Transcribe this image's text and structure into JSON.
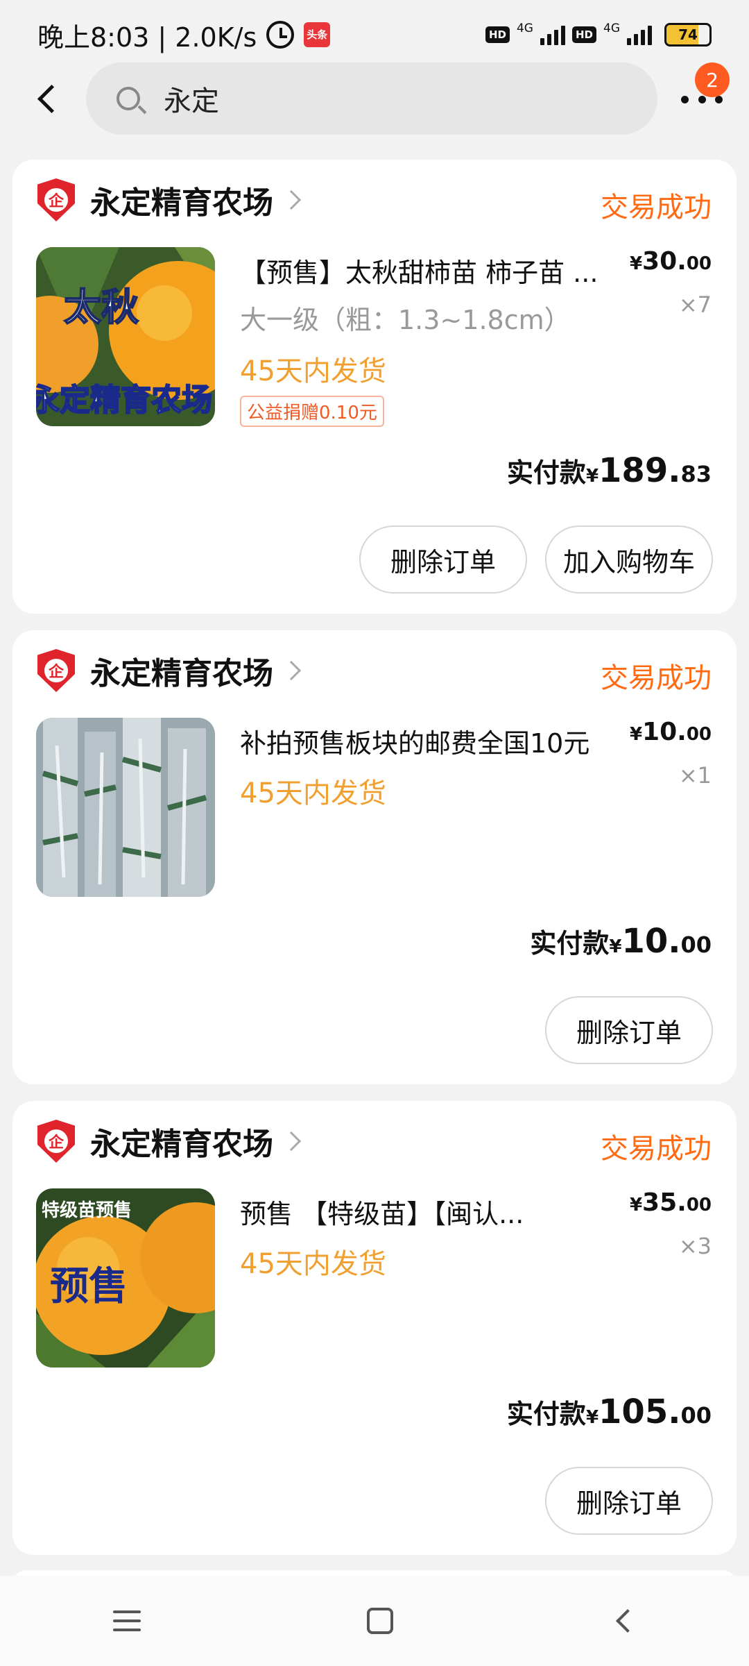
{
  "status_bar": {
    "time_speed": "晚上8:03 | 2.0K/s",
    "news_label": "头条",
    "hd_label": "HD",
    "network_label": "4G",
    "battery": "74",
    "battery_fill": 0.74
  },
  "header": {
    "search_text": "永定",
    "message_count": "2"
  },
  "orders": [
    {
      "shop_name": "永定精育农场",
      "shop_badge": "企",
      "status": "交易成功",
      "title": "【预售】太秋甜柿苗 柿子苗 ...",
      "spec": "大一级（粗：1.3~1.8cm）",
      "shipping": "45天内发货",
      "donation": "公益捐赠0.10元",
      "price_int": "30.",
      "price_dec": "00",
      "quantity": "×7",
      "paid_label": "实付款",
      "paid_int": "189.",
      "paid_dec": "83",
      "buttons": [
        "删除订单",
        "加入购物车"
      ],
      "image_text": "太秋",
      "image_caption": "永定精育农场"
    },
    {
      "shop_name": "永定精育农场",
      "shop_badge": "企",
      "status": "交易成功",
      "title": "补拍预售板块的邮费全国10元",
      "shipping": "45天内发货",
      "price_int": "10.",
      "price_dec": "00",
      "quantity": "×1",
      "paid_label": "实付款",
      "paid_int": "10.",
      "paid_dec": "00",
      "buttons": [
        "删除订单"
      ]
    },
    {
      "shop_name": "永定精育农场",
      "shop_badge": "企",
      "status": "交易成功",
      "title": "预售 【特级苗】【闽认...",
      "shipping": "45天内发货",
      "price_int": "35.",
      "price_dec": "00",
      "quantity": "×3",
      "paid_label": "实付款",
      "paid_int": "105.",
      "paid_dec": "00",
      "buttons": [
        "删除订单"
      ],
      "image_text": "预售",
      "image_caption": "特级苗预售"
    }
  ],
  "currency_symbol": "¥",
  "colors": {
    "accent": "#ff6a13",
    "shipping": "#f0a030",
    "shop_badge": "#e0242b"
  }
}
